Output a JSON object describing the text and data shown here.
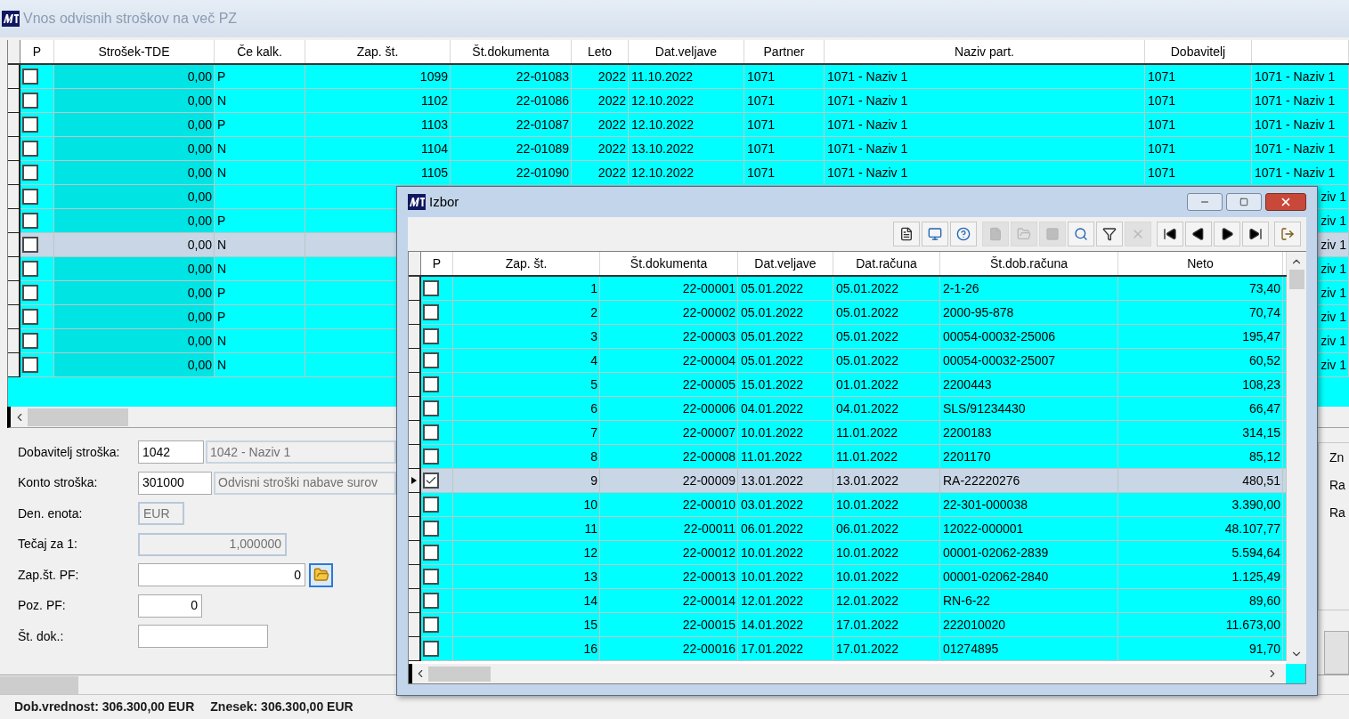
{
  "window": {
    "title": "Vnos odvisnih stroškov na več PZ"
  },
  "main_grid": {
    "check_column": "P",
    "columns": [
      "Strošek-TDE",
      "Če kalk.",
      "Zap. št.",
      "Št.dokumenta",
      "Leto",
      "Dat.veljave",
      "Partner",
      "Naziv part.",
      "Dobavitelj"
    ],
    "rows": [
      {
        "selected": false,
        "checked": false,
        "cells": [
          "0,00",
          "P",
          "1099",
          "22-01083",
          "2022",
          "11.10.2022",
          "1071",
          "1071 - Naziv 1",
          "1071",
          "1071 - Naziv 1"
        ]
      },
      {
        "selected": false,
        "checked": false,
        "cells": [
          "0,00",
          "N",
          "1102",
          "22-01086",
          "2022",
          "12.10.2022",
          "1071",
          "1071 - Naziv 1",
          "1071",
          "1071 - Naziv 1"
        ]
      },
      {
        "selected": false,
        "checked": false,
        "cells": [
          "0,00",
          "P",
          "1103",
          "22-01087",
          "2022",
          "12.10.2022",
          "1071",
          "1071 - Naziv 1",
          "1071",
          "1071 - Naziv 1"
        ]
      },
      {
        "selected": false,
        "checked": false,
        "cells": [
          "0,00",
          "N",
          "1104",
          "22-01089",
          "2022",
          "13.10.2022",
          "1071",
          "1071 - Naziv 1",
          "1071",
          "1071 - Naziv 1"
        ]
      },
      {
        "selected": false,
        "checked": false,
        "cells": [
          "0,00",
          "N",
          "1105",
          "22-01090",
          "2022",
          "12.10.2022",
          "1071",
          "1071 - Naziv 1",
          "1071",
          "1071 - Naziv 1"
        ]
      },
      {
        "selected": false,
        "checked": false,
        "cells": [
          "0,00"
        ],
        "tail": "ziv 1"
      },
      {
        "selected": false,
        "checked": false,
        "cells": [
          "0,00",
          "P"
        ],
        "tail": "ziv 1"
      },
      {
        "selected": true,
        "checked": false,
        "cells": [
          "0,00",
          "N"
        ],
        "tail": "ziv 1"
      },
      {
        "selected": false,
        "checked": false,
        "cells": [
          "0,00",
          "N"
        ],
        "tail": "ziv 1"
      },
      {
        "selected": false,
        "checked": false,
        "cells": [
          "0,00",
          "P"
        ],
        "tail": "ziv 1"
      },
      {
        "selected": false,
        "checked": false,
        "cells": [
          "0,00",
          "P"
        ],
        "tail": "ziv 1"
      },
      {
        "selected": false,
        "checked": false,
        "cells": [
          "0,00",
          "N"
        ],
        "tail": "ziv 1"
      },
      {
        "selected": false,
        "checked": false,
        "cells": [
          "0,00",
          "N"
        ],
        "tail": "ziv 1"
      }
    ]
  },
  "form": [
    {
      "label": "Dobavitelj stroška:",
      "value": "1042",
      "kind": "short",
      "extra": "1042 - Naziv 1"
    },
    {
      "label": "Konto stroška:",
      "value": "301000",
      "kind": "code",
      "extra": "Odvisni stroški nabave surov"
    },
    {
      "label": "Den. enota:",
      "value": "EUR",
      "kind": "currency"
    },
    {
      "label": "Tečaj za 1:",
      "value": "1,000000",
      "kind": "rate"
    },
    {
      "label": "Zap.št. PF:",
      "value": "0",
      "kind": "browse"
    },
    {
      "label": "Poz. PF:",
      "value": "0",
      "kind": "small"
    },
    {
      "label": "Št. dok.:",
      "kind": "text"
    }
  ],
  "right_panel": {
    "labels": [
      "Zn",
      "Ra",
      "Ra"
    ]
  },
  "status_bar": [
    "Dob.vrednost: 306.300,00 EUR",
    "Znesek: 306.300,00 EUR"
  ],
  "dialog": {
    "title": "Izbor",
    "toolbar": [
      {
        "kind": "report",
        "disabled": false
      },
      {
        "kind": "preview",
        "disabled": false
      },
      {
        "kind": "help",
        "disabled": false
      },
      {
        "kind": "new",
        "disabled": true
      },
      {
        "kind": "edit",
        "disabled": true
      },
      {
        "kind": "delete-record",
        "disabled": true
      },
      {
        "kind": "search",
        "disabled": false
      },
      {
        "kind": "filter",
        "disabled": false
      },
      {
        "kind": "clear",
        "disabled": true
      },
      {
        "kind": "first",
        "disabled": false
      },
      {
        "kind": "prev",
        "disabled": false
      },
      {
        "kind": "next",
        "disabled": false
      },
      {
        "kind": "last",
        "disabled": false
      },
      {
        "kind": "exit",
        "disabled": false
      }
    ],
    "check_column": "P",
    "columns": [
      "Zap. št.",
      "Št.dokumenta",
      "Dat.veljave",
      "Dat.računa",
      "Št.dob.računa",
      "Neto"
    ],
    "rows": [
      {
        "selected": false,
        "checked": false,
        "cells": [
          "1",
          "22-00001",
          "05.01.2022",
          "05.01.2022",
          "2-1-26",
          "73,40"
        ]
      },
      {
        "selected": false,
        "checked": false,
        "cells": [
          "2",
          "22-00002",
          "05.01.2022",
          "05.01.2022",
          "2000-95-878",
          "70,74"
        ]
      },
      {
        "selected": false,
        "checked": false,
        "cells": [
          "3",
          "22-00003",
          "05.01.2022",
          "05.01.2022",
          "00054-00032-25006",
          "195,47"
        ]
      },
      {
        "selected": false,
        "checked": false,
        "cells": [
          "4",
          "22-00004",
          "05.01.2022",
          "05.01.2022",
          "00054-00032-25007",
          "60,52"
        ]
      },
      {
        "selected": false,
        "checked": false,
        "cells": [
          "5",
          "22-00005",
          "15.01.2022",
          "01.01.2022",
          "2200443",
          "108,23"
        ]
      },
      {
        "selected": false,
        "checked": false,
        "cells": [
          "6",
          "22-00006",
          "04.01.2022",
          "04.01.2022",
          "SLS/91234430",
          "66,47"
        ]
      },
      {
        "selected": false,
        "checked": false,
        "cells": [
          "7",
          "22-00007",
          "10.01.2022",
          "11.01.2022",
          "2200183",
          "314,15"
        ]
      },
      {
        "selected": false,
        "checked": false,
        "cells": [
          "8",
          "22-00008",
          "11.01.2022",
          "11.01.2022",
          "2201170",
          "85,12"
        ]
      },
      {
        "selected": true,
        "checked": true,
        "cells": [
          "9",
          "22-00009",
          "13.01.2022",
          "13.01.2022",
          "RA-22220276",
          "480,51"
        ]
      },
      {
        "selected": false,
        "checked": false,
        "cells": [
          "10",
          "22-00010",
          "03.01.2022",
          "10.01.2022",
          "22-301-000038",
          "3.390,00"
        ]
      },
      {
        "selected": false,
        "checked": false,
        "cells": [
          "11",
          "22-00011",
          "06.01.2022",
          "06.01.2022",
          "12022-000001",
          "48.107,77"
        ]
      },
      {
        "selected": false,
        "checked": false,
        "cells": [
          "12",
          "22-00012",
          "10.01.2022",
          "10.01.2022",
          "00001-02062-2839",
          "5.594,64"
        ]
      },
      {
        "selected": false,
        "checked": false,
        "cells": [
          "13",
          "22-00013",
          "10.01.2022",
          "10.01.2022",
          "00001-02062-2840",
          "1.125,49"
        ]
      },
      {
        "selected": false,
        "checked": false,
        "cells": [
          "14",
          "22-00014",
          "12.01.2022",
          "12.01.2022",
          "RN-6-22",
          "89,60"
        ]
      },
      {
        "selected": false,
        "checked": false,
        "cells": [
          "15",
          "22-00015",
          "14.01.2022",
          "17.01.2022",
          "222010020",
          "11.673,00"
        ]
      },
      {
        "selected": false,
        "checked": false,
        "cells": [
          "16",
          "22-00016",
          "17.01.2022",
          "17.01.2022",
          "01274895",
          "91,70"
        ]
      }
    ]
  }
}
